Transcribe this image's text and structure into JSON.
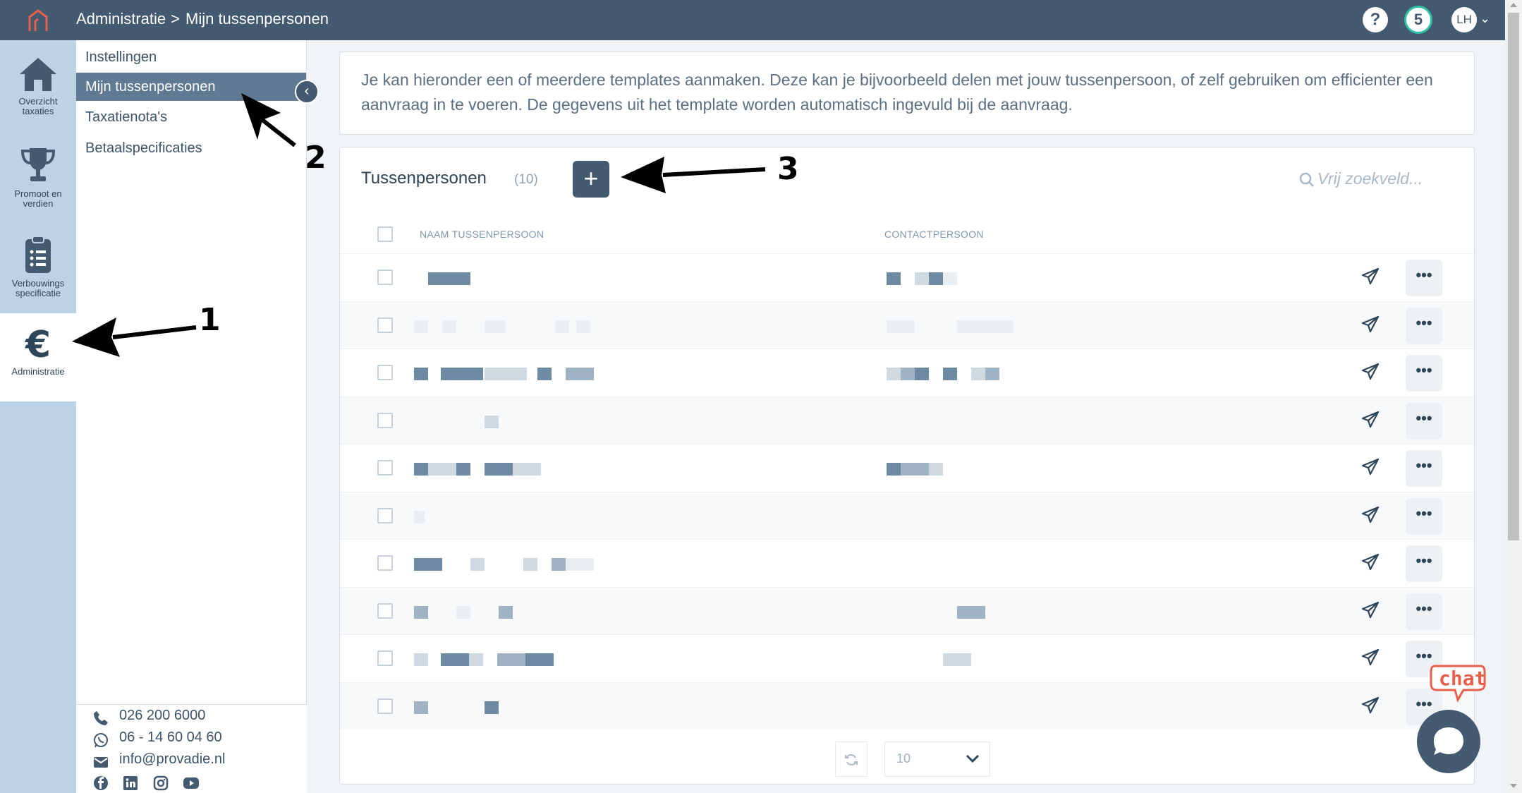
{
  "topbar": {
    "breadcrumb": [
      "Administratie",
      "Mijn tussenpersonen"
    ],
    "separator": ">",
    "help": "?",
    "notifications_count": "5",
    "user_initials": "LH",
    "bg_color": "#435a70",
    "logo_color": "#e8604c"
  },
  "iconnav": {
    "items": [
      {
        "label": "Overzicht taxaties",
        "icon": "home-icon"
      },
      {
        "label": "Promoot en verdien",
        "icon": "trophy-icon"
      },
      {
        "label": "Verbouwings specificatie",
        "icon": "clipboard-list-icon"
      },
      {
        "label": "Administratie",
        "icon": "euro-icon",
        "active": true
      }
    ]
  },
  "submenu": {
    "items": [
      {
        "label": "Instellingen"
      },
      {
        "label": "Mijn tussenpersonen",
        "active": true
      },
      {
        "label": "Taxatienota's"
      },
      {
        "label": "Betaalspecificaties"
      }
    ]
  },
  "contact": {
    "phone": "026 200 6000",
    "whatsapp": "06 - 14 60 04 60",
    "email": "info@provadie.nl",
    "socials": [
      "facebook-icon",
      "linkedin-icon",
      "instagram-icon",
      "youtube-icon"
    ]
  },
  "info": {
    "text": "Je kan hieronder een of meerdere templates aanmaken. Deze kan je bijvoorbeeld delen met jouw tussenpersoon, of zelf gebruiken om efficienter een aanvraag in te voeren. De gegevens uit het template worden automatisch ingevuld bij de aanvraag."
  },
  "panel": {
    "title": "Tussenpersonen",
    "count": "(10)",
    "add_label": "+",
    "search_placeholder": "Vrij zoekveld...",
    "columns": [
      "NAAM TUSSENPERSOON",
      "CONTACTPERSOON"
    ],
    "rows_redacted": 10,
    "row_more_label": "•••",
    "page_size": "10"
  },
  "annotations": {
    "labels": [
      "1",
      "2",
      "3"
    ]
  },
  "chat": {
    "label": "chat",
    "color": "#e8604c"
  }
}
